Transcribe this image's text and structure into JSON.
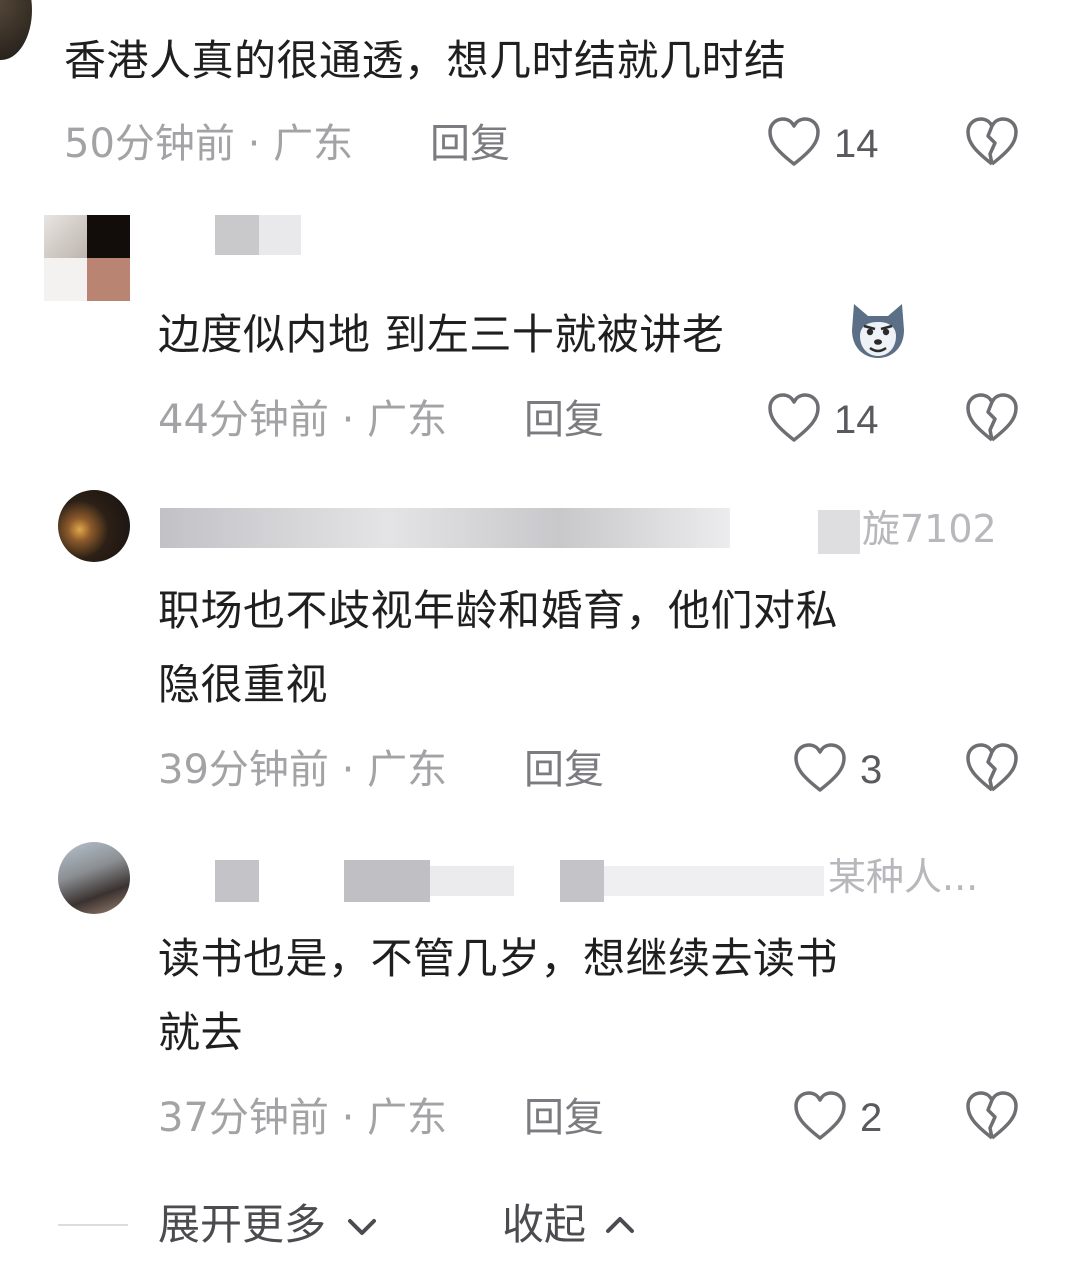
{
  "comments": [
    {
      "content_lines": [
        "香港人真的很通透，想几时结就几时结"
      ],
      "time": "50分钟前",
      "location": "广东",
      "reply_label": "回复",
      "likes": "14"
    },
    {
      "content_lines": [
        "边度似内地 到左三十就被讲老"
      ],
      "emoji": "wolf-emoji",
      "time": "44分钟前",
      "location": "广东",
      "reply_label": "回复",
      "likes": "14"
    },
    {
      "name_partial": "旋7102",
      "content_lines": [
        "职场也不歧视年龄和婚育，他们对私",
        "隐很重视"
      ],
      "time": "39分钟前",
      "location": "广东",
      "reply_label": "回复",
      "likes": "3"
    },
    {
      "name_partial": "某种人...",
      "content_lines": [
        "读书也是，不管几岁，想继续去读书",
        "就去"
      ],
      "time": "37分钟前",
      "location": "广东",
      "reply_label": "回复",
      "likes": "2"
    }
  ],
  "separator": "·",
  "footer": {
    "expand_label": "展开更多",
    "collapse_label": "收起"
  },
  "colors": {
    "text": "#1f1f1f",
    "meta": "#a3a3a6",
    "icon": "#6f6f73"
  }
}
